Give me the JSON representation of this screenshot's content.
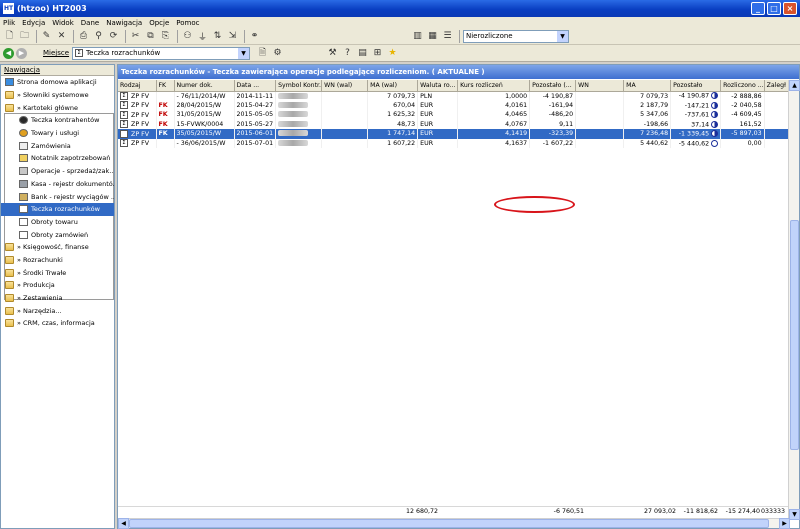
{
  "window": {
    "title": "(htzoo)  HT2003",
    "app_icon": "HT",
    "buttons": [
      "_",
      "□",
      "×"
    ]
  },
  "menu": [
    "Plik",
    "Edycja",
    "Widok",
    "Dane",
    "Nawigacja",
    "Opcje",
    "Pomoc"
  ],
  "toolbar": {
    "filter_value": "Nierozliczone"
  },
  "location": {
    "label": "Miejsce",
    "value": "Teczka rozrachunków"
  },
  "nav": {
    "header": "Nawigacja",
    "items": [
      {
        "label": "Strona domowa aplikacji",
        "level": 1,
        "icon": "home-icon"
      },
      {
        "label": "» Słowniki systemowe",
        "level": 1,
        "icon": "folder-icon"
      },
      {
        "label": "» Kartoteki główne",
        "level": 1,
        "icon": "folder-open-icon"
      },
      {
        "label": "Teczka kontrahentów",
        "level": 2,
        "icon": "contractors-icon"
      },
      {
        "label": "Towary i usługi",
        "level": 2,
        "icon": "products-icon"
      },
      {
        "label": "Zamówienia",
        "level": 2,
        "icon": "orders-icon"
      },
      {
        "label": "Notatnik zapotrzebowań",
        "level": 2,
        "icon": "notebook-icon"
      },
      {
        "label": "Operacje - sprzedaż/zak...",
        "level": 2,
        "icon": "operations-icon"
      },
      {
        "label": "Kasa - rejestr dokumentó...",
        "level": 2,
        "icon": "cash-register-icon"
      },
      {
        "label": "Bank - rejestr wyciągów ...",
        "level": 2,
        "icon": "bank-icon"
      },
      {
        "label": "Teczka rozrachunków",
        "level": 2,
        "icon": "settlements-icon",
        "selected": true
      },
      {
        "label": "Obroty towaru",
        "level": 2,
        "icon": "document-icon"
      },
      {
        "label": "Obroty zamówień",
        "level": 2,
        "icon": "document-icon"
      },
      {
        "label": "» Księgowość, finanse",
        "level": 1,
        "icon": "folder-icon"
      },
      {
        "label": "» Rozrachunki",
        "level": 1,
        "icon": "folder-icon"
      },
      {
        "label": "» Środki Trwałe",
        "level": 1,
        "icon": "folder-icon"
      },
      {
        "label": "» Produkcja",
        "level": 1,
        "icon": "folder-icon"
      },
      {
        "label": "» Zestawienia",
        "level": 1,
        "icon": "folder-icon"
      },
      {
        "label": "» Narzędzia...",
        "level": 1,
        "icon": "folder-icon"
      },
      {
        "label": "» CRM, czas, informacja",
        "level": 1,
        "icon": "folder-icon"
      }
    ]
  },
  "main": {
    "header": "Teczka rozrachunków - Teczka zawierająca operacje podlegające rozliczeniom.  ( AKTUALNE )",
    "columns": [
      "Rodzaj",
      "FK",
      "Numer dok.",
      "Data ...",
      "Symbol Kontr.",
      "WN (wal)",
      "MA (wal)",
      "Waluta ro...",
      "Kurs rozliczeń",
      "Pozostało (...",
      "WN",
      "MA",
      "Pozostało",
      "Rozliczono ...",
      "Zaległ"
    ],
    "rows": [
      {
        "rodzaj": "ZP FV",
        "fk": "",
        "numer": "- 76/11/2014/W",
        "data": "2014-11-11",
        "wn_wal": "",
        "ma_wal": "7 079,73",
        "waluta": "PLN",
        "kurs": "1,0000",
        "pozostalo_wal": "-4 190,87",
        "wn": "",
        "ma": "7 079,73",
        "pozostalo": "-4 190,87",
        "status": "half",
        "rozliczono": "-2 888,86"
      },
      {
        "rodzaj": "ZP FV",
        "fk": "FK",
        "numer": "28/04/2015/W",
        "data": "2015-04-27",
        "wn_wal": "",
        "ma_wal": "670,04",
        "waluta": "EUR",
        "kurs": "4,0161",
        "pozostalo_wal": "-161,94",
        "wn": "",
        "ma": "2 187,79",
        "pozostalo": "-147,21",
        "status": "half",
        "rozliczono": "-2 040,58"
      },
      {
        "rodzaj": "ZP FV",
        "fk": "FK",
        "numer": "31/05/2015/W",
        "data": "2015-05-05",
        "wn_wal": "",
        "ma_wal": "1 625,32",
        "waluta": "EUR",
        "kurs": "4,0465",
        "pozostalo_wal": "-486,20",
        "wn": "",
        "ma": "5 347,06",
        "pozostalo": "-737,61",
        "status": "half",
        "rozliczono": "-4 609,45"
      },
      {
        "rodzaj": "ZP FV",
        "fk": "FK",
        "numer": "15-FVWK/0004",
        "data": "2015-05-27",
        "wn_wal": "",
        "ma_wal": "48,73",
        "waluta": "EUR",
        "kurs": "4,0767",
        "pozostalo_wal": "9,11",
        "wn": "",
        "ma": "-198,66",
        "pozostalo": "37,14",
        "status": "half",
        "rozliczono": "161,52"
      },
      {
        "rodzaj": "ZP FV",
        "fk": "FK",
        "numer": "35/05/2015/W",
        "data": "2015-06-01",
        "wn_wal": "",
        "ma_wal": "1 747,14",
        "waluta": "EUR",
        "kurs": "4,1419",
        "pozostalo_wal": "-323,39",
        "wn": "",
        "ma": "7 236,48",
        "pozostalo": "-1 339,45",
        "status": "half",
        "rozliczono": "-5 897,03",
        "selected": true
      },
      {
        "rodzaj": "ZP FV",
        "fk": "",
        "numer": "- 36/06/2015/W",
        "data": "2015-07-01",
        "wn_wal": "",
        "ma_wal": "1 607,22",
        "waluta": "EUR",
        "kurs": "4,1637",
        "pozostalo_wal": "-1 607,22",
        "wn": "",
        "ma": "5 440,62",
        "pozostalo": "-5 440,62",
        "status": "empty",
        "rozliczono": "0,00"
      }
    ],
    "totals": {
      "ma_wal": "12 680,72",
      "pozostalo_wal": "-6 760,51",
      "ma": "27 093,02",
      "pozostalo": "-11 818,62",
      "rozliczono": "-15 274,40",
      "zalegl": "033333"
    }
  }
}
